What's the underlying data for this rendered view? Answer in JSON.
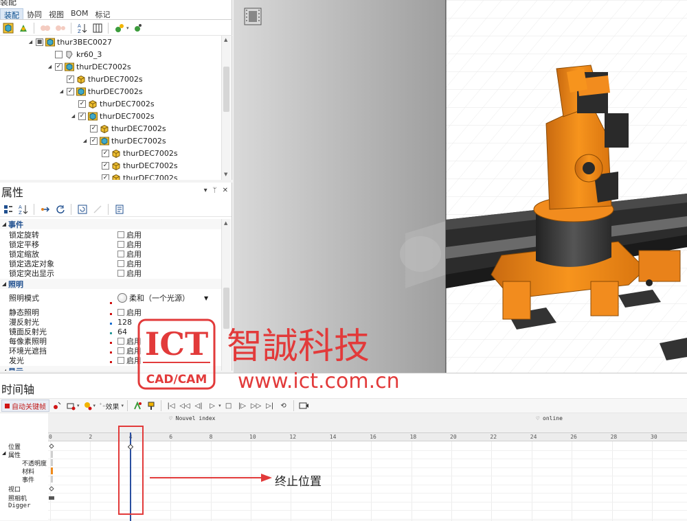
{
  "assembly": {
    "title": "装配",
    "tabs": [
      "装配",
      "协同",
      "视图",
      "BOM",
      "标记"
    ],
    "tree": [
      {
        "label": "thur3BEC0027",
        "type": "assembly",
        "check": "partial",
        "expanded": true
      },
      {
        "label": "kr60_3",
        "type": "part-gray",
        "check": "none"
      },
      {
        "label": "thurDEC7002s",
        "type": "assembly",
        "check": "checked",
        "expanded": true
      },
      {
        "label": "thurDEC7002s",
        "type": "part",
        "check": "checked"
      },
      {
        "label": "thurDEC7002s",
        "type": "assembly",
        "check": "checked",
        "expanded": true
      },
      {
        "label": "thurDEC7002s",
        "type": "part",
        "check": "checked"
      },
      {
        "label": "thurDEC7002s",
        "type": "assembly",
        "check": "checked",
        "expanded": true
      },
      {
        "label": "thurDEC7002s",
        "type": "part",
        "check": "checked"
      },
      {
        "label": "thurDEC7002s",
        "type": "assembly",
        "check": "checked",
        "expanded": true
      },
      {
        "label": "thurDEC7002s",
        "type": "part",
        "check": "checked"
      },
      {
        "label": "thurDEC7002s",
        "type": "part",
        "check": "checked"
      },
      {
        "label": "thurDEC7002s",
        "type": "part",
        "check": "checked"
      }
    ]
  },
  "properties": {
    "title": "属性",
    "controls": [
      "▾",
      "ᛘ",
      "✕"
    ],
    "categories": [
      {
        "name": "事件",
        "rows": [
          {
            "name": "锁定旋转",
            "value": "启用"
          },
          {
            "name": "锁定平移",
            "value": "启用"
          },
          {
            "name": "锁定缩放",
            "value": "启用"
          },
          {
            "name": "锁定选定对象",
            "value": "启用"
          },
          {
            "name": "锁定突出显示",
            "value": "启用"
          }
        ]
      },
      {
        "name": "照明",
        "rows": [
          {
            "name": "照明模式",
            "value": "柔和（一个光源）"
          },
          {
            "name": "静态照明",
            "value": "启用"
          },
          {
            "name": "漫反射光",
            "value": "128"
          },
          {
            "name": "镜面反射光",
            "value": "64"
          },
          {
            "name": "每像素照明",
            "value": "启用"
          },
          {
            "name": "环境光遮挡",
            "value": "启用"
          },
          {
            "name": "发光",
            "value": "启用"
          }
        ]
      },
      {
        "name": "显示",
        "rows": []
      }
    ]
  },
  "timeline": {
    "title": "时间轴",
    "autokey_label": "自动关键帧",
    "effects_label": "效果",
    "markers": [
      {
        "label": "Nouvel index",
        "time": 6.2
      },
      {
        "label": "online",
        "time": 24.5
      }
    ],
    "ruler_ticks": [
      0,
      2,
      4,
      6,
      8,
      10,
      12,
      14,
      16,
      18,
      20,
      22,
      24,
      26,
      28,
      30
    ],
    "playhead_time": 4,
    "tracks": [
      {
        "label": "位置",
        "level": 0
      },
      {
        "label": "属性",
        "level": 0
      },
      {
        "label": "不透明度",
        "level": 1
      },
      {
        "label": "材料",
        "level": 1
      },
      {
        "label": "事件",
        "level": 1
      },
      {
        "label": "视口",
        "level": 0
      },
      {
        "label": "照相机",
        "level": 0
      },
      {
        "label": "Digger",
        "level": 0
      }
    ],
    "annotation": "终止位置"
  },
  "watermark": {
    "logo_text": "ICT",
    "logo_sub": "CAD/CAM",
    "company": "智誠科技",
    "url": "www.ict.com.cn"
  },
  "colors": {
    "robot": "#f08a1a",
    "accent": "#1f4f8f",
    "playhead": "#2a4fa0",
    "highlight_box": "#e23a3a",
    "watermark": "#e23a3a"
  }
}
